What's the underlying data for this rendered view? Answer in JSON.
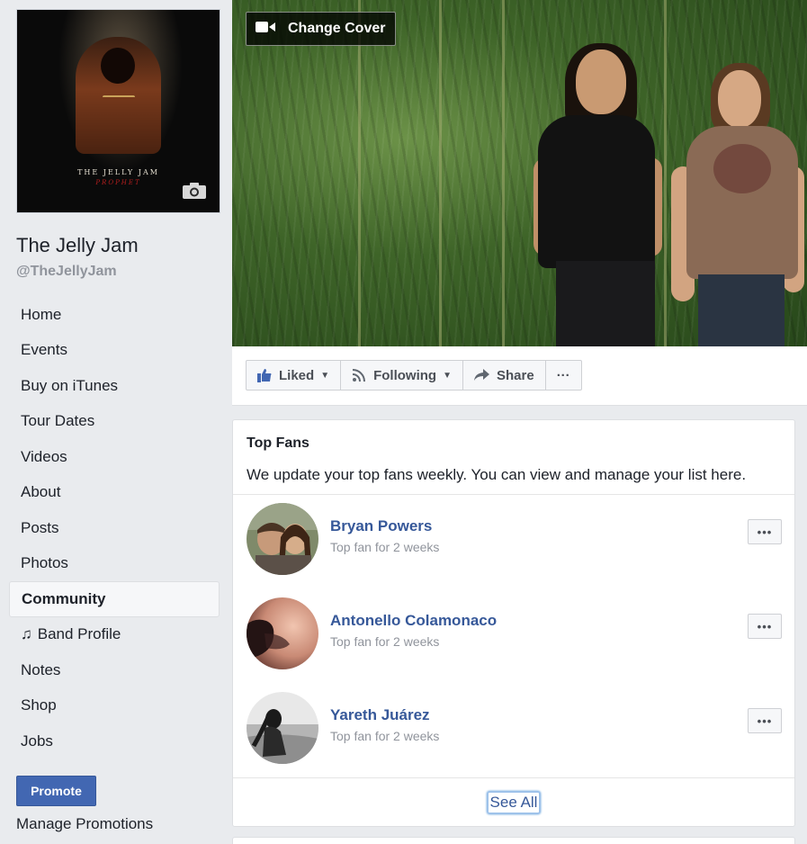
{
  "page": {
    "name": "The Jelly Jam",
    "handle": "@TheJellyJam",
    "album_art_title": "THE JELLY JAM",
    "album_art_subtitle": "PROPHET",
    "album_art_script": "Prophet"
  },
  "sidebar": {
    "items": [
      {
        "label": "Home",
        "active": false
      },
      {
        "label": "Events",
        "active": false
      },
      {
        "label": "Buy on iTunes",
        "active": false
      },
      {
        "label": "Tour Dates",
        "active": false
      },
      {
        "label": "Videos",
        "active": false
      },
      {
        "label": "About",
        "active": false
      },
      {
        "label": "Posts",
        "active": false
      },
      {
        "label": "Photos",
        "active": false
      },
      {
        "label": "Community",
        "active": true
      },
      {
        "label": "Band Profile",
        "active": false,
        "icon": "music-note-icon",
        "glyph": "♫"
      },
      {
        "label": "Notes",
        "active": false
      },
      {
        "label": "Shop",
        "active": false
      },
      {
        "label": "Jobs",
        "active": false
      }
    ],
    "promote_label": "Promote",
    "manage_promotions_label": "Manage Promotions"
  },
  "cover": {
    "change_cover_label": "Change Cover"
  },
  "actions": {
    "liked_label": "Liked",
    "following_label": "Following",
    "share_label": "Share",
    "more_label": "···"
  },
  "top_fans": {
    "title": "Top Fans",
    "description": "We update your top fans weekly. You can view and manage your list here.",
    "fans": [
      {
        "name": "Bryan Powers",
        "meta": "Top fan for 2 weeks"
      },
      {
        "name": "Antonello Colamonaco",
        "meta": "Top fan for 2 weeks"
      },
      {
        "name": "Yareth Juárez",
        "meta": "Top fan for 2 weeks"
      }
    ],
    "more_label": "•••",
    "see_all_label": "See All"
  },
  "colors": {
    "background": "#e9ebee",
    "link_blue": "#365899",
    "brand_blue": "#4267b2",
    "muted_text": "#90949c"
  }
}
